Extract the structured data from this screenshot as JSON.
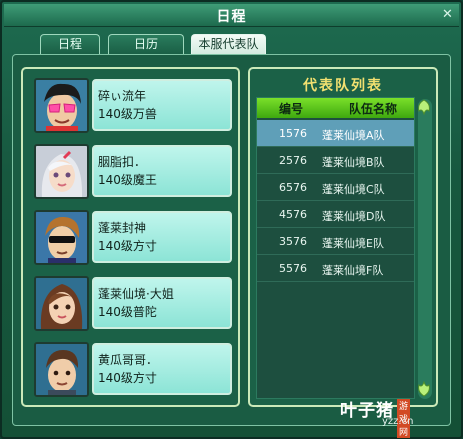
{
  "window": {
    "title": "日程",
    "close_glyph": "✕"
  },
  "tabs": [
    {
      "label": "日程",
      "active": false
    },
    {
      "label": "日历",
      "active": false
    },
    {
      "label": "本服代表队",
      "active": true
    }
  ],
  "members": [
    {
      "name": "碎ぃ流年",
      "level": "140级万兽"
    },
    {
      "name": "胭脂扣．",
      "level": "140级魔王"
    },
    {
      "name": "蓬莱封神",
      "level": "140级方寸"
    },
    {
      "name": "蓬莱仙境·大姐",
      "level": "140级普陀"
    },
    {
      "name": "黄瓜哥哥．",
      "level": "140级方寸"
    }
  ],
  "team_list": {
    "title": "代表队列表",
    "headers": {
      "id": "编号",
      "name": "队伍名称"
    },
    "rows": [
      {
        "id": "1576",
        "name": "蓬莱仙境A队",
        "selected": true
      },
      {
        "id": "2576",
        "name": "蓬莱仙境B队",
        "selected": false
      },
      {
        "id": "6576",
        "name": "蓬莱仙境C队",
        "selected": false
      },
      {
        "id": "4576",
        "name": "蓬莱仙境D队",
        "selected": false
      },
      {
        "id": "3576",
        "name": "蓬莱仙境E队",
        "selected": false
      },
      {
        "id": "5576",
        "name": "蓬莱仙境F队",
        "selected": false
      }
    ]
  },
  "watermark": {
    "brand": "叶子猪",
    "tag": "游戏网",
    "url": "yzz.cn"
  },
  "colors": {
    "accent": "#f2e070",
    "selected_row": "#5f9fb8",
    "header_green": "#5cc41c"
  }
}
